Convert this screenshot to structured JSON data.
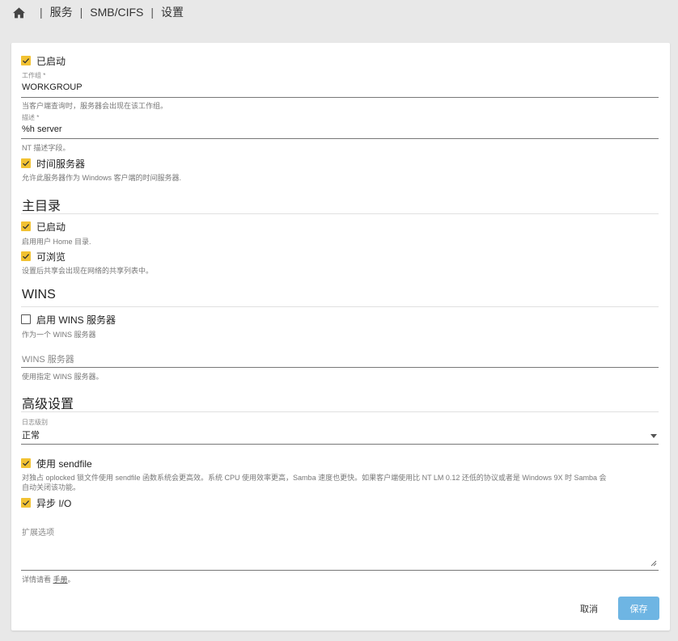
{
  "breadcrumb": {
    "items": [
      "服务",
      "SMB/CIFS",
      "设置"
    ],
    "separator": "|"
  },
  "general": {
    "enabled_label": "已启动",
    "enabled": true,
    "workgroup_label": "工作组 *",
    "workgroup_value": "WORKGROUP",
    "workgroup_hint": "当客户端查询时，服务器会出现在该工作组。",
    "description_label": "描述 *",
    "description_value": "%h server",
    "description_hint": "NT 描述字段。",
    "time_server_label": "时间服务器",
    "time_server_enabled": true,
    "time_server_hint": "允许此服务器作为 Windows 客户端的时间服务器."
  },
  "home_dir": {
    "title": "主目录",
    "enabled_label": "已启动",
    "enabled": true,
    "enabled_hint": "启用用户 Home 目录.",
    "browseable_label": "可浏览",
    "browseable": true,
    "browseable_hint": "设置后共享会出现在网络的共享列表中。"
  },
  "wins": {
    "title": "WINS",
    "enable_label": "启用 WINS 服务器",
    "enabled": false,
    "enable_hint": "作为一个 WINS 服务器",
    "server_placeholder": "WINS 服务器",
    "server_hint": "使用指定 WINS 服务器。"
  },
  "advanced": {
    "title": "高级设置",
    "log_level_label": "日志级别",
    "log_level_value": "正常",
    "sendfile_label": "使用 sendfile",
    "sendfile_enabled": true,
    "sendfile_hint": "对独占 oplocked 锁文件使用 sendfile 函数系统会更高效。系统 CPU 使用效率更高，Samba 速度也更快。如果客户端使用比 NT LM 0.12 还低的协议或者是 Windows 9X 时 Samba 会",
    "sendfile_hint2": "自动关闭该功能。",
    "async_io_label": "异步 I/O",
    "async_io_enabled": true,
    "extra_options_label": "扩展选项",
    "extra_options_hint_prefix": "详情请看 ",
    "extra_options_hint_link": "手册",
    "extra_options_hint_suffix": "。"
  },
  "actions": {
    "cancel_label": "取消",
    "save_label": "保存"
  },
  "colors": {
    "checkbox_accent": "#f2c232",
    "save_button": "#6eb5e3"
  }
}
